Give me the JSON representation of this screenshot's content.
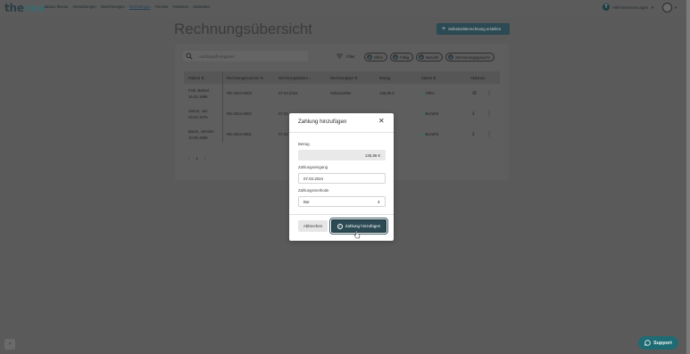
{
  "topbar": {
    "logo_main": "the",
    "logo_accent": "vea",
    "nav": [
      "Jabaco thevea",
      "Verordnungen",
      "Abrechnungen",
      "Rechnungen",
      "Termine",
      "Patienten",
      "Statistiken"
    ],
    "active_nav": "Rechnungen",
    "user_initial": "T",
    "user_label": "Hilfe/Verbesserungen"
  },
  "page": {
    "title": "Rechnungsübersicht",
    "create_button": "Selbstzahlerrechnung erstellen"
  },
  "search": {
    "placeholder": "Suchbegriff eingeben"
  },
  "filter": {
    "label": "Filter",
    "chips": [
      "Offen",
      "Fällig",
      "Bezahlt",
      "Stornierungsgebucht"
    ]
  },
  "table": {
    "headers": [
      "Patient",
      "Rechnungsnummer",
      "Rechnungsdatum",
      "Rechnungsart",
      "Betrag",
      "Status",
      "Aktionen"
    ],
    "rows": [
      {
        "patient_name": "Fink, Bärbel",
        "patient_dob": "16.02.1996",
        "number": "RE-2024-0003",
        "date": "07.03.2024",
        "type": "Selbstzahler",
        "amount": "135,86 €",
        "status": "Offen"
      },
      {
        "patient_name": "Simon, Jan",
        "patient_dob": "03.02.1975",
        "number": "RE-2024-0002",
        "date": "07.03",
        "type": "",
        "amount": "",
        "status": "Bezahlt"
      },
      {
        "patient_name": "Baum, Jennifer",
        "patient_dob": "10.06.1968",
        "number": "RE-2024-0001",
        "date": "07.03",
        "type": "",
        "amount": "",
        "status": "Bezahlt"
      }
    ]
  },
  "pagination": {
    "prev": "‹",
    "current": "1",
    "next": "›"
  },
  "modal": {
    "title": "Zahlung hinzufügen",
    "amount_label": "Betrag",
    "amount_value": "135,86 €",
    "date_label": "Zahlungseingang",
    "date_value": "07.03.2024",
    "method_label": "Zahlungsmethode",
    "method_value": "Bar",
    "cancel_label": "Abbrechen",
    "submit_label": "Zahlung hinzufügen"
  },
  "support": {
    "label": "Support"
  },
  "colors": {
    "primary": "#2b4a53",
    "support": "#1f6b73",
    "status_green": "#2a7a4b"
  }
}
